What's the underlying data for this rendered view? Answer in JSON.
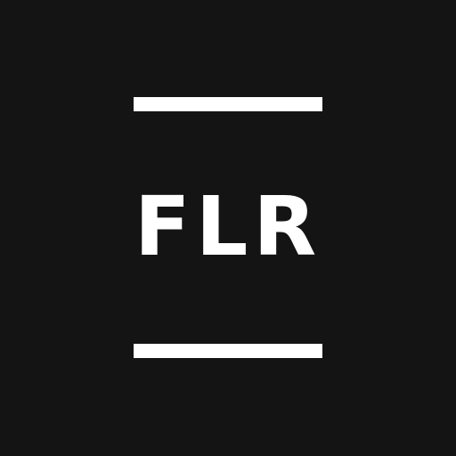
{
  "logo": {
    "text": "FLR"
  },
  "colors": {
    "background": "#141414",
    "foreground": "#ffffff"
  }
}
